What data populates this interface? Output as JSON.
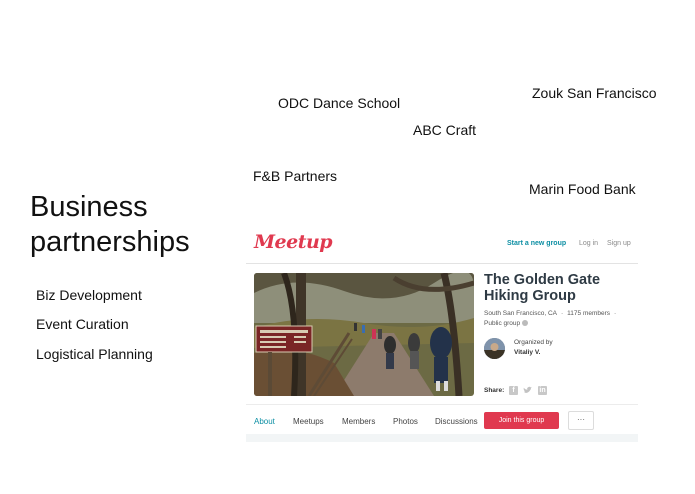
{
  "slide": {
    "title": "Business partnerships",
    "skills": [
      "Biz Development",
      "Event Curation",
      "Logistical Planning"
    ],
    "partners": {
      "odc": "ODC Dance School",
      "zouk": "Zouk San Francisco",
      "abc": "ABC Craft",
      "fb": "F&B Partners",
      "marin": "Marin Food Bank"
    }
  },
  "meetup": {
    "logo": "Meetup",
    "nav": {
      "start_group": "Start a new group",
      "login": "Log in",
      "signup": "Sign up"
    },
    "group": {
      "title": "The Golden Gate Hiking Group",
      "location": "South San Francisco, CA",
      "members": "1175 members",
      "visibility": "Public group",
      "organized_by_label": "Organized by",
      "organizer": "Vitaliy V.",
      "share_label": "Share:"
    },
    "tabs": [
      "About",
      "Meetups",
      "Members",
      "Photos",
      "Discussions"
    ],
    "join_label": "Join this group",
    "more_label": "···",
    "colors": {
      "brand": "#e0394f",
      "accent": "#0b8ea3"
    }
  }
}
